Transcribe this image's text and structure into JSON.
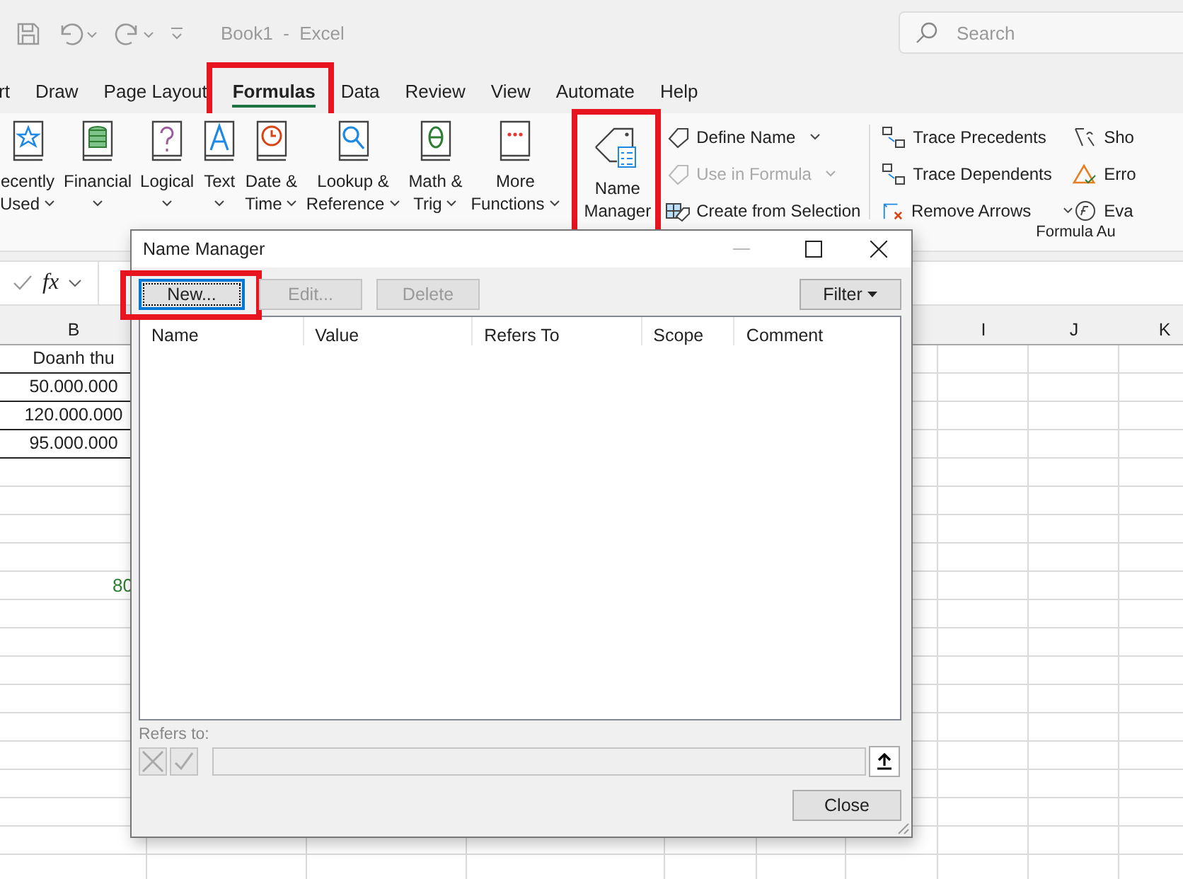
{
  "title_bar": {
    "title": "Book1  -  Excel",
    "search": {
      "placeholder": "Search"
    }
  },
  "tabs": [
    {
      "label": "rt",
      "selected": false,
      "highlighted": false
    },
    {
      "label": "Draw",
      "selected": false,
      "highlighted": false
    },
    {
      "label": "Page Layout",
      "selected": false,
      "highlighted": false
    },
    {
      "label": "Formulas",
      "selected": true,
      "highlighted": true
    },
    {
      "label": "Data",
      "selected": false,
      "highlighted": false
    },
    {
      "label": "Review",
      "selected": false,
      "highlighted": false
    },
    {
      "label": "View",
      "selected": false,
      "highlighted": false
    },
    {
      "label": "Automate",
      "selected": false,
      "highlighted": false
    },
    {
      "label": "Help",
      "selected": false,
      "highlighted": false
    }
  ],
  "ribbon": {
    "function_buttons": [
      {
        "lines": [
          "ecently",
          "Used"
        ],
        "dropdown": true
      },
      {
        "lines": [
          "Financial"
        ],
        "dropdown": true
      },
      {
        "lines": [
          "Logical"
        ],
        "dropdown": true
      },
      {
        "lines": [
          "Text"
        ],
        "dropdown": true
      },
      {
        "lines": [
          "Date &",
          "Time"
        ],
        "dropdown": true
      },
      {
        "lines": [
          "Lookup &",
          "Reference"
        ],
        "dropdown": true
      },
      {
        "lines": [
          "Math &",
          "Trig"
        ],
        "dropdown": true
      },
      {
        "lines": [
          "More",
          "Functions"
        ],
        "dropdown": true
      }
    ],
    "name_manager": {
      "lines": [
        "Name",
        "Manager"
      ],
      "highlighted": true
    },
    "defined_names": [
      {
        "label": "Define Name",
        "dropdown": true,
        "disabled": false
      },
      {
        "label": "Use in Formula",
        "dropdown": true,
        "disabled": true
      },
      {
        "label": "Create from Selection",
        "dropdown": false,
        "disabled": false
      }
    ],
    "auditing": [
      {
        "label": "Trace Precedents",
        "dropdown": false
      },
      {
        "label": "Trace Dependents",
        "dropdown": false
      },
      {
        "label": "Remove Arrows",
        "dropdown": true
      }
    ],
    "auditing_cut": [
      "Sho",
      "Erro",
      "Eva"
    ],
    "group_label": "Formula Au"
  },
  "formula_bar": {
    "fx": "fx"
  },
  "sheet": {
    "columns": [
      "B",
      "I",
      "J",
      "K"
    ],
    "cells": [
      {
        "text": "Doanh thu",
        "kind": "bordered"
      },
      {
        "text": "50.000.000",
        "kind": "bordered"
      },
      {
        "text": "120.000.000",
        "kind": "bordered"
      },
      {
        "text": "95.000.000",
        "kind": "bordered"
      },
      {
        "text": "80",
        "kind": "accent"
      }
    ]
  },
  "dialog": {
    "title": "Name Manager",
    "buttons": [
      {
        "label": "New...",
        "disabled": false,
        "focused": true,
        "highlighted": true
      },
      {
        "label": "Edit...",
        "disabled": true,
        "focused": false,
        "highlighted": false
      },
      {
        "label": "Delete",
        "disabled": true,
        "focused": false,
        "highlighted": false
      }
    ],
    "filter": "Filter",
    "columns": [
      "Name",
      "Value",
      "Refers To",
      "Scope",
      "Comment"
    ],
    "refers_to_label": "Refers to:",
    "close": "Close"
  }
}
